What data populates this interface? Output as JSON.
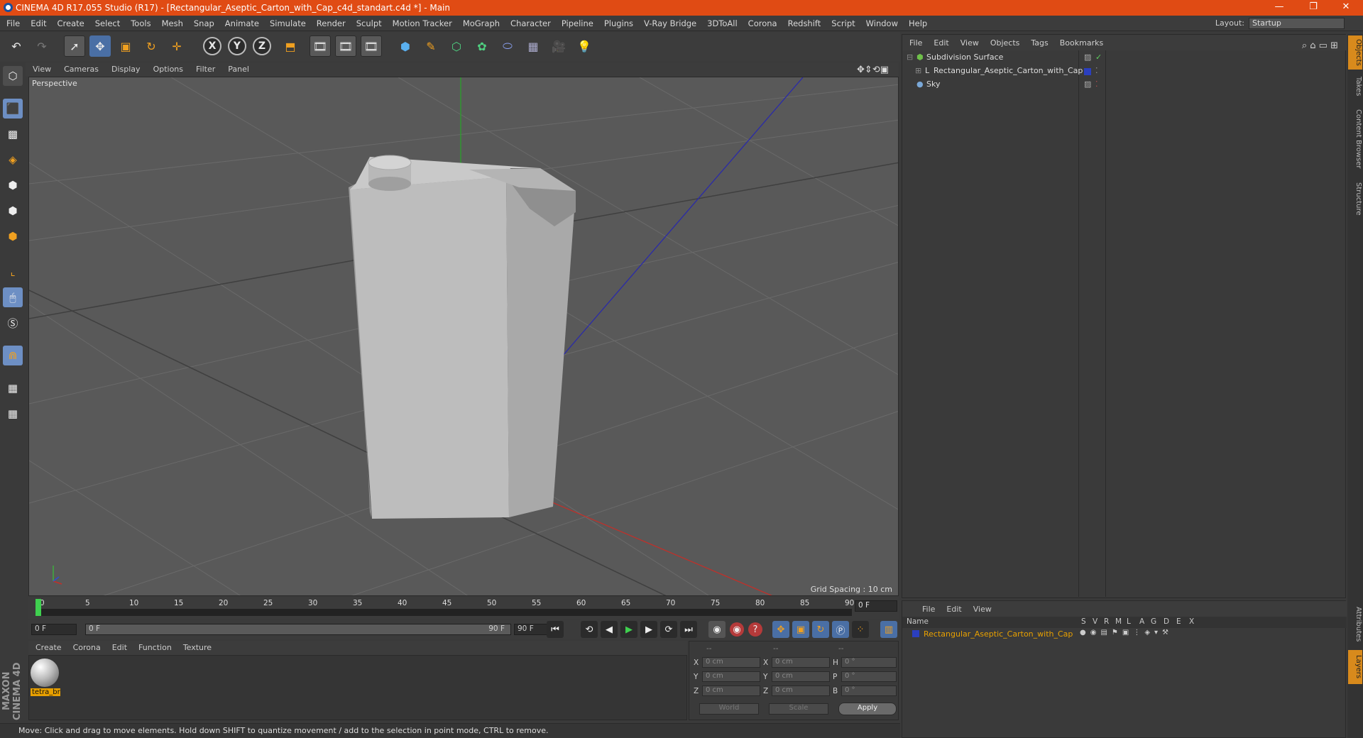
{
  "window": {
    "title": "CINEMA 4D R17.055 Studio (R17) - [Rectangular_Aseptic_Carton_with_Cap_c4d_standart.c4d *] - Main",
    "min": "—",
    "max": "❐",
    "close": "✕"
  },
  "menu": [
    "File",
    "Edit",
    "Create",
    "Select",
    "Tools",
    "Mesh",
    "Snap",
    "Animate",
    "Simulate",
    "Render",
    "Sculpt",
    "Motion Tracker",
    "MoGraph",
    "Character",
    "Pipeline",
    "Plugins",
    "V-Ray Bridge",
    "3DToAll",
    "Corona",
    "Redshift",
    "Script",
    "Window",
    "Help"
  ],
  "layout": {
    "label": "Layout:",
    "value": "Startup"
  },
  "toolbar": {
    "axis_x": "X",
    "axis_y": "Y",
    "axis_z": "Z"
  },
  "viewport": {
    "menu": [
      "View",
      "Cameras",
      "Display",
      "Options",
      "Filter",
      "Panel"
    ],
    "label": "Perspective",
    "grid_spacing": "Grid Spacing : 10 cm"
  },
  "timeline": {
    "ticks": [
      "0",
      "5",
      "10",
      "15",
      "20",
      "25",
      "30",
      "35",
      "40",
      "45",
      "50",
      "55",
      "60",
      "65",
      "70",
      "75",
      "80",
      "85",
      "90"
    ],
    "current": "0 F",
    "start": "0 F",
    "range_start": "0 F",
    "range_end": "90 F",
    "end": "90 F"
  },
  "material": {
    "menu": [
      "Create",
      "Corona",
      "Edit",
      "Function",
      "Texture"
    ],
    "items": [
      {
        "name": "tetra_br"
      }
    ]
  },
  "coords": {
    "headers": [
      "--",
      "--",
      "--"
    ],
    "rows": [
      {
        "a": "X",
        "av": "0 cm",
        "b": "X",
        "bv": "0 cm",
        "c": "H",
        "cv": "0 °"
      },
      {
        "a": "Y",
        "av": "0 cm",
        "b": "Y",
        "bv": "0 cm",
        "c": "P",
        "cv": "0 °"
      },
      {
        "a": "Z",
        "av": "0 cm",
        "b": "Z",
        "bv": "0 cm",
        "c": "B",
        "cv": "0 °"
      }
    ],
    "mode1": "World",
    "mode2": "Scale",
    "apply": "Apply"
  },
  "status": "Move: Click and drag to move elements. Hold down SHIFT to quantize movement / add to the selection in point mode, CTRL to remove.",
  "objects": {
    "menu": [
      "File",
      "Edit",
      "View",
      "Objects",
      "Tags",
      "Bookmarks"
    ],
    "items": [
      {
        "name": "Subdivision Surface",
        "color": "#6fc04a"
      },
      {
        "name": "Rectangular_Aseptic_Carton_with_Cap",
        "color": "#ddd"
      },
      {
        "name": "Sky",
        "color": "#7aa8d8"
      }
    ]
  },
  "layers": {
    "menu": [
      "File",
      "Edit",
      "View"
    ],
    "col_name": "Name",
    "cols": [
      "S",
      "V",
      "R",
      "M",
      "L",
      "A",
      "G",
      "D",
      "E",
      "X"
    ],
    "row": "Rectangular_Aseptic_Carton_with_Cap",
    "row_color": "#2b3fbf"
  },
  "right_tabs": [
    "Objects",
    "Takes",
    "Content Browser",
    "Structure",
    "Attributes",
    "Layers"
  ],
  "logo": "MAXON CINEMA 4D",
  "colors": {
    "titlebar": "#e04b14",
    "accent_blue": "#6d8fc4",
    "highlight_orange": "#e8a000"
  }
}
